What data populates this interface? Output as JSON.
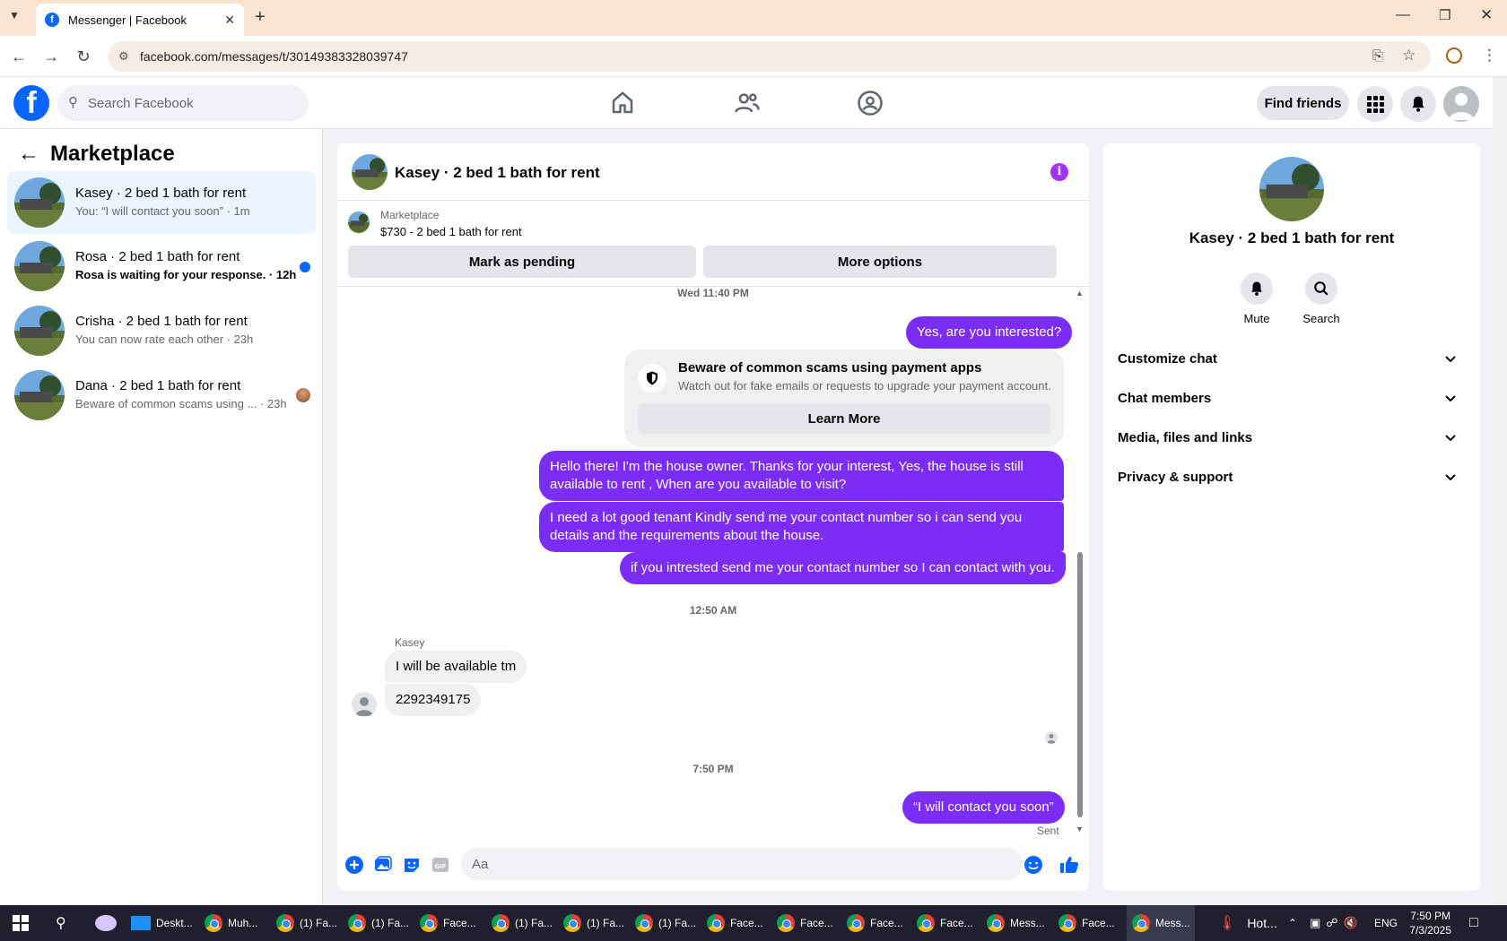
{
  "browser": {
    "tab_title": "Messenger | Facebook",
    "url": "facebook.com/messages/t/30149383328039747"
  },
  "fb": {
    "search_placeholder": "Search Facebook",
    "find_friends": "Find friends"
  },
  "left": {
    "title": "Marketplace",
    "conversations": [
      {
        "name": "Kasey · 2 bed 1 bath for rent",
        "preview": "You: “I will contact you soon” · 1m",
        "unread": false
      },
      {
        "name": "Rosa · 2 bed 1 bath for rent",
        "preview": "Rosa is waiting for your response. · 12h",
        "unread": true
      },
      {
        "name": "Crisha · 2 bed 1 bath for rent",
        "preview": "You can now rate each other · 23h",
        "unread": false
      },
      {
        "name": "Dana · 2 bed 1 bath for rent",
        "preview": "Beware of common scams using ... · 23h",
        "unread": false
      }
    ]
  },
  "chat": {
    "title": "Kasey · 2 bed 1 bath for rent",
    "listing_source": "Marketplace",
    "listing_title": "$730 - 2 bed 1 bath for rent",
    "mark_pending": "Mark as pending",
    "more_options": "More options",
    "timestamps": [
      "Wed 11:40 PM",
      "12:50 AM",
      "7:50 PM"
    ],
    "messages": {
      "m1": "Yes, are you interested?",
      "m2": "Hello there! I'm the house owner. Thanks for your interest, Yes, the house is still available to rent , When are you available to visit?",
      "m3": "I need a lot good tenant Kindly send me your contact number so i can send you details and the requirements about the house.",
      "m4": "if you intrested send me your contact number so I can contact with you.",
      "sender": "Kasey",
      "r1": "I will be available tm",
      "r2": "2292349175",
      "m5": "“I will contact you soon”",
      "sent": "Sent"
    },
    "scam_notice": {
      "title": "Beware of common scams using payment apps",
      "body": "Watch out for fake emails or requests to upgrade your payment account.",
      "button": "Learn More"
    },
    "composer_placeholder": "Aa"
  },
  "right": {
    "name": "Kasey · 2 bed 1 bath for rent",
    "mute": "Mute",
    "search": "Search",
    "sections": [
      "Customize chat",
      "Chat members",
      "Media, files and links",
      "Privacy & support"
    ]
  },
  "taskbar": {
    "items": [
      "Deskt...",
      "Muh...",
      "(1) Fa...",
      "(1) Fa...",
      "Face...",
      "(1) Fa...",
      "(1) Fa...",
      "(1) Fa...",
      "Face...",
      "Face...",
      "Face...",
      "Face...",
      "Mess...",
      "Face...",
      "Mess..."
    ],
    "weather": "Hot...",
    "lang": "ENG",
    "time": "7:50 PM",
    "date": "7/3/2025"
  },
  "colors": {
    "brand": "#0866ff",
    "outgoing_bubble": "#7b2cf5",
    "accent_purple": "#a033ff"
  }
}
